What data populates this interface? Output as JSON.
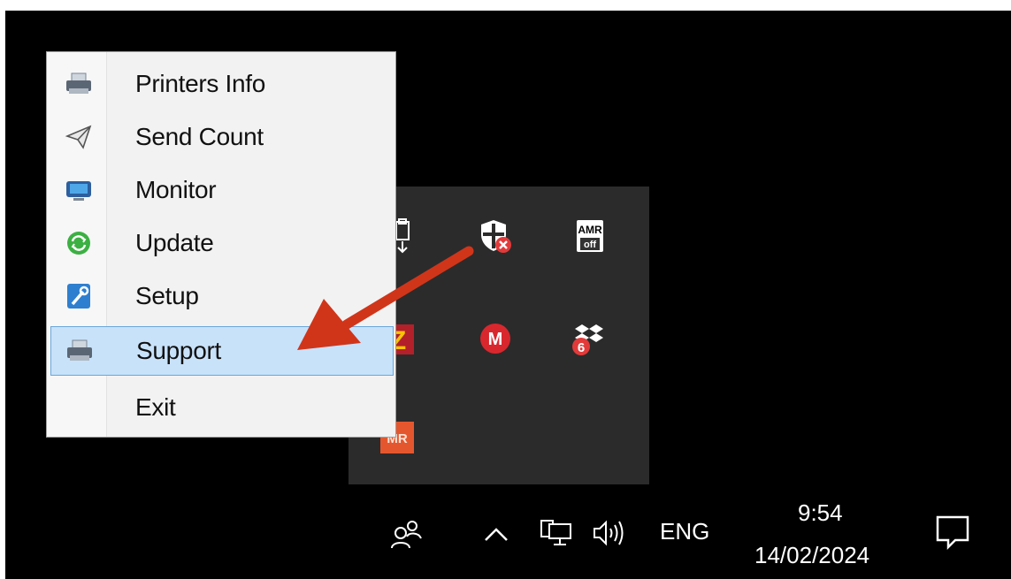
{
  "context_menu": {
    "items": [
      {
        "label": "Printers Info",
        "icon": "printer-icon"
      },
      {
        "label": "Send Count",
        "icon": "paper-plane-icon"
      },
      {
        "label": "Monitor",
        "icon": "monitor-icon"
      },
      {
        "label": "Update",
        "icon": "refresh-icon"
      },
      {
        "label": "Setup",
        "icon": "wrench-icon"
      },
      {
        "label": "Support",
        "icon": "printer-icon",
        "selected": true
      },
      {
        "label": "Exit",
        "icon": ""
      }
    ]
  },
  "tray_flyout": {
    "icons": [
      {
        "name": "usb-eject-icon"
      },
      {
        "name": "security-shield-warning-icon"
      },
      {
        "name": "amr-off-icon",
        "label_top": "AMR",
        "label_bottom": "off"
      },
      {
        "name": "filezilla-icon",
        "label": "Z"
      },
      {
        "name": "mega-icon",
        "label": "M"
      },
      {
        "name": "dropbox-sync-icon",
        "badge": "6"
      },
      {
        "name": "amr-icon",
        "label": "MR"
      }
    ]
  },
  "taskbar": {
    "time": "9:54",
    "date": "14/02/2024",
    "language": "ENG",
    "icons": [
      "people-icon",
      "chevron-up-icon",
      "network-icon",
      "volume-icon",
      "notification-icon"
    ]
  },
  "annotation": {
    "arrow_color": "#d0351a"
  },
  "colors": {
    "menu_selected_bg": "#c8e2fa",
    "menu_selected_border": "#6aa6da",
    "flyout_bg": "#2b2b2b"
  }
}
